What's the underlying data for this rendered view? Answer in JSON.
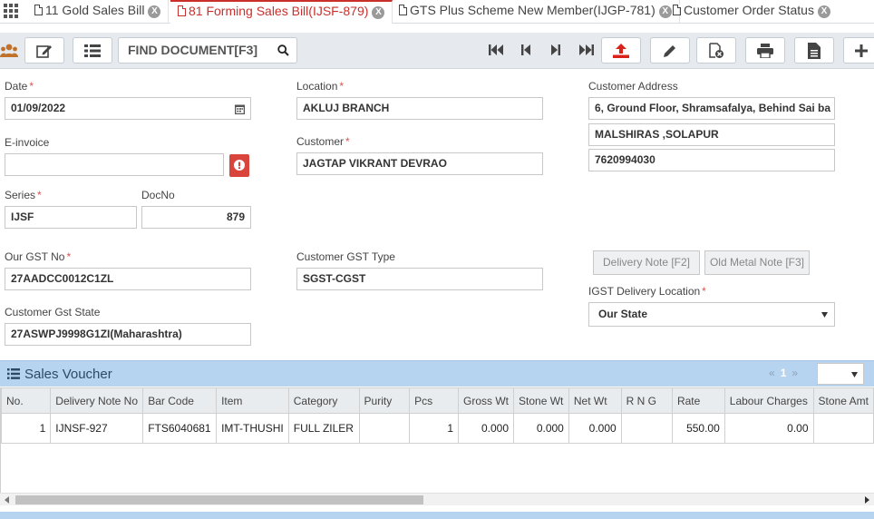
{
  "tabs": [
    {
      "label": "11 Gold Sales Bill",
      "active": false
    },
    {
      "label": "81 Forming Sales Bill(IJSF-879)",
      "active": true
    },
    {
      "label": "GTS Plus Scheme New Member(IJGP-781)",
      "active": false
    },
    {
      "label": "Customer Order Status",
      "active": false
    }
  ],
  "tab_close_glyph": "X",
  "toolbar": {
    "find_placeholder": "FIND DOCUMENT[F3]"
  },
  "form": {
    "date_label": "Date",
    "date_value": "01/09/2022",
    "einvoice_label": "E-invoice",
    "einvoice_value": "",
    "series_label": "Series",
    "series_value": "IJSF",
    "docno_label": "DocNo",
    "docno_value": "879",
    "gst_label": "Our GST No",
    "gst_value": "27AADCC0012C1ZL",
    "cust_gst_state_label": "Customer Gst State",
    "cust_gst_state_value": "27ASWPJ9998G1ZI(Maharashtra)",
    "location_label": "Location",
    "location_value": "AKLUJ BRANCH",
    "customer_label": "Customer",
    "customer_value": "JAGTAP VIKRANT DEVRAO",
    "cust_gst_type_label": "Customer GST Type",
    "cust_gst_type_value": "SGST-CGST",
    "address_label": "Customer Address",
    "address_line1": "6, Ground Floor, Shramsafalya, Behind Sai ba",
    "address_line2": "MALSHIRAS ,SOLAPUR",
    "address_line3": "7620994030",
    "delivery_note_btn": "Delivery Note [F2]",
    "old_metal_btn": "Old Metal Note [F3]",
    "igst_label": "IGST Delivery Location",
    "igst_value": "Our State",
    "required_mark": "*"
  },
  "voucher": {
    "title": "Sales Voucher",
    "pager_prev": "«",
    "pager_page": "1",
    "pager_next": "»",
    "columns": [
      "No.",
      "Delivery Note No",
      "Bar Code",
      "Item",
      "Category",
      "Purity",
      "Pcs",
      "Gross Wt",
      "Stone Wt",
      "Net Wt",
      "R N G",
      "Rate",
      "Labour Charges",
      "Stone Amt"
    ],
    "rows": [
      [
        "1",
        "IJNSF-927",
        "FTS6040681",
        "IMT-THUSHI",
        "FULL ZILER",
        "",
        "1",
        "0.000",
        "0.000",
        "0.000",
        "",
        "550.00",
        "0.00",
        ""
      ]
    ]
  },
  "colors": {
    "accent": "#c9302c",
    "panel": "#b6d4f0",
    "toolbar": "#e6eaee"
  }
}
